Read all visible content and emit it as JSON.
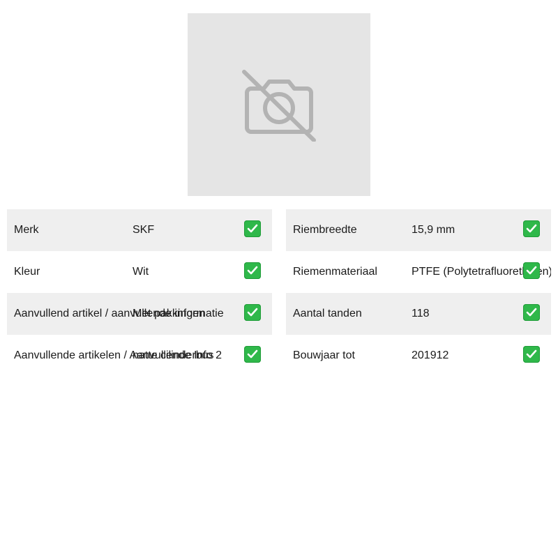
{
  "image": {
    "placeholder_icon": "no-camera-icon",
    "background": "#e5e5e5",
    "icon_color": "#b3b3b3"
  },
  "colors": {
    "row_shade": "#efefef",
    "check_green": "#2fb84a"
  },
  "left_table": {
    "rows": [
      {
        "label": "Merk",
        "value": "SKF",
        "icon": "check-mark-icon"
      },
      {
        "label": "Kleur",
        "value": "Wit",
        "icon": "check-mark-icon"
      },
      {
        "label": "Aanvullend artikel / aanvullende informatie",
        "value": "Met pakkingen",
        "icon": "check-mark-icon"
      },
      {
        "label": "Aanvullende artikelen / Aanvullende Info 2",
        "value": "natte cilinderbus",
        "icon": "check-mark-icon"
      }
    ]
  },
  "right_table": {
    "rows": [
      {
        "label": "Riembreedte",
        "value": "15,9 mm",
        "icon": "check-mark-icon"
      },
      {
        "label": "Riemenmateriaal",
        "value": "PTFE (Polytetrafluorethylen)",
        "icon": "check-mark-icon"
      },
      {
        "label": "Aantal tanden",
        "value": "118",
        "icon": "check-mark-icon"
      },
      {
        "label": "Bouwjaar tot",
        "value": "201912",
        "icon": "check-mark-icon"
      }
    ]
  }
}
